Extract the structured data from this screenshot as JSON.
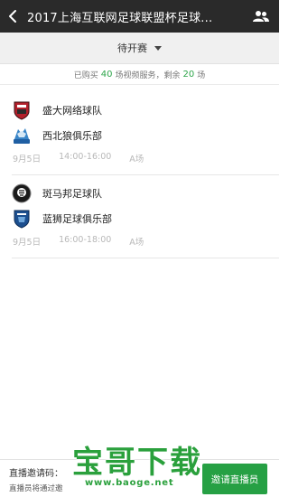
{
  "header": {
    "title": "2017上海互联网足球联盟杯足球..."
  },
  "filter": {
    "label": "待开赛"
  },
  "service": {
    "prefix": "已购买",
    "bought": "40",
    "middle": "场视频服务，剩余",
    "remaining": "20",
    "suffix": "场"
  },
  "matches": [
    {
      "home": "盛大网络球队",
      "away": "西北狼俱乐部",
      "date": "9月5日",
      "time": "14:00-16:00",
      "field": "A场"
    },
    {
      "home": "斑马邦足球队",
      "away": "蓝狮足球俱乐部",
      "date": "9月5日",
      "time": "16:00-18:00",
      "field": "A场"
    }
  ],
  "bottom": {
    "code_label": "直播邀请码：",
    "hint": "直播员将通过邀",
    "invite_button": "邀请直播员"
  },
  "watermark": {
    "title": "宝哥下载",
    "url": "www.baoge.net"
  },
  "colors": {
    "accent": "#26a044",
    "topbar": "#2a2a2a"
  }
}
